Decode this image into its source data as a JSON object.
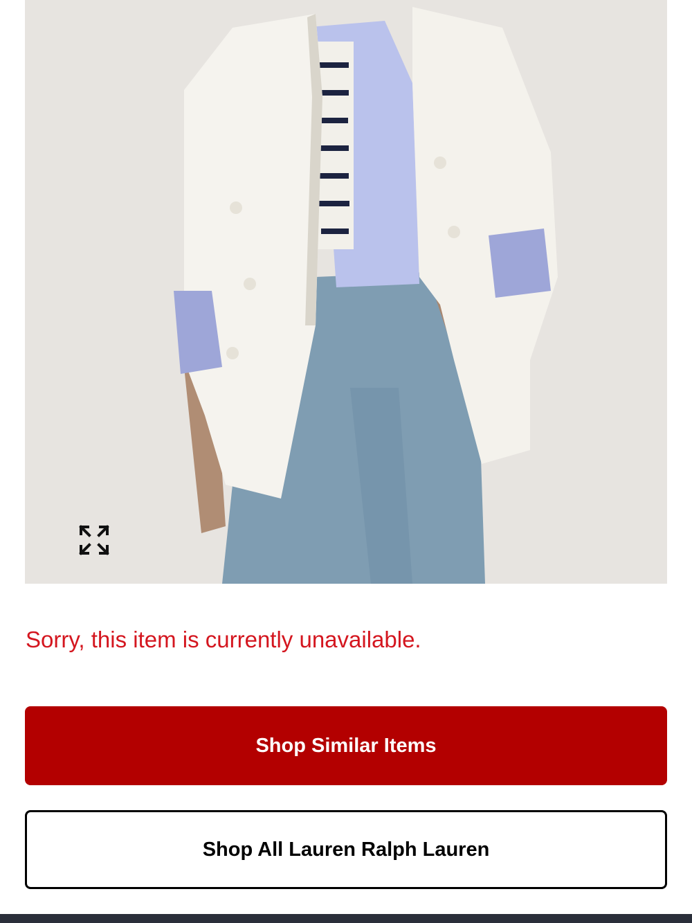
{
  "product": {
    "image_alt": "Model wearing white double-breasted blazer, blue oxford shirt, striped sweater and light wash jeans",
    "expand_icon": "expand-arrows-icon"
  },
  "status": {
    "message": "Sorry, this item is currently unavailable.",
    "color": "#d4161f"
  },
  "actions": {
    "shop_similar_label": "Shop Similar Items",
    "shop_all_label": "Shop All Lauren Ralph Lauren",
    "primary_color": "#b30000"
  }
}
